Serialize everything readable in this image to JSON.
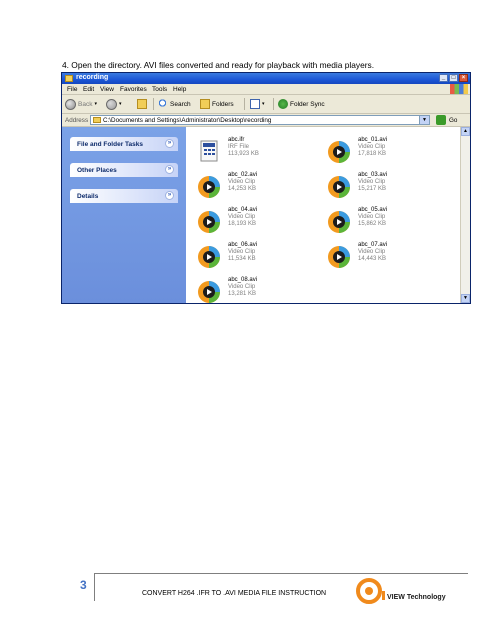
{
  "instruction": "4. Open the directory.  AVI files converted and ready for playback with media players.",
  "window": {
    "title": "recording",
    "controls": {
      "minimize": "_",
      "maximize": "□",
      "close": "×"
    },
    "menu": [
      "File",
      "Edit",
      "View",
      "Favorites",
      "Tools",
      "Help"
    ],
    "toolbar": {
      "back": "Back",
      "search": "Search",
      "folders": "Folders",
      "folder_sync": "Folder Sync"
    },
    "address": {
      "label": "Address",
      "value": "C:\\Documents and Settings\\Administrator\\Desktop\\recording",
      "go": "Go"
    },
    "tasks": [
      {
        "label": "File and Folder Tasks"
      },
      {
        "label": "Other Places"
      },
      {
        "label": "Details"
      }
    ],
    "files": [
      {
        "name": "abc.ifr",
        "type": "IRF File",
        "size": "113,923 KB",
        "icon": "ifr-file-icon"
      },
      {
        "name": "abc_01.avi",
        "type": "Video Clip",
        "size": "17,818 KB",
        "icon": "media-player-icon"
      },
      {
        "name": "abc_02.avi",
        "type": "Video Clip",
        "size": "14,253 KB",
        "icon": "media-player-icon"
      },
      {
        "name": "abc_03.avi",
        "type": "Video Clip",
        "size": "15,217 KB",
        "icon": "media-player-icon"
      },
      {
        "name": "abc_04.avi",
        "type": "Video Clip",
        "size": "18,193 KB",
        "icon": "media-player-icon"
      },
      {
        "name": "abc_05.avi",
        "type": "Video Clip",
        "size": "15,862 KB",
        "icon": "media-player-icon"
      },
      {
        "name": "abc_06.avi",
        "type": "Video Clip",
        "size": "11,534 KB",
        "icon": "media-player-icon"
      },
      {
        "name": "abc_07.avi",
        "type": "Video Clip",
        "size": "14,443 KB",
        "icon": "media-player-icon"
      },
      {
        "name": "abc_08.avi",
        "type": "Video Clip",
        "size": "13,281 KB",
        "icon": "media-player-icon"
      }
    ]
  },
  "footer": {
    "page_number": "3",
    "text": "CONVERT H264 .IFR TO .AVI MEDIA FILE INSTRUCTION",
    "logo_text": "VIEW Technology"
  },
  "colors": {
    "accent": "#4472c4",
    "titlebar": "#1c56d6",
    "sidepane": "#7ba2e7",
    "logo_orange": "#f08a1c"
  }
}
